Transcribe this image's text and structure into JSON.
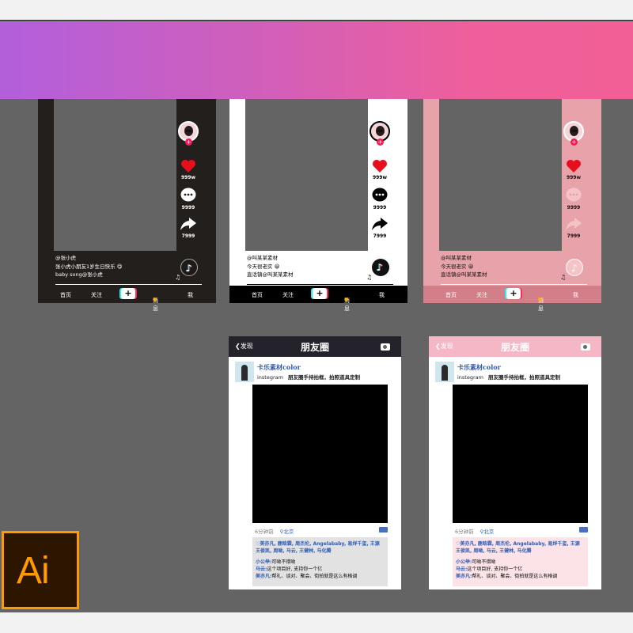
{
  "colors": {
    "canvas": "#646464",
    "banner_start": "#b25fdc",
    "banner_end": "#f25f96",
    "heart": "#e5101c",
    "ai_orange": "#ff9a00"
  },
  "tiktok": [
    {
      "theme": "black",
      "counts": {
        "likes": "999w",
        "comments": "9999",
        "shares": "7999"
      },
      "caption": {
        "user": "@张小虎",
        "desc": "张小虎小朋友1岁生日快乐 😋",
        "song": "baby song@张小虎"
      },
      "nav": {
        "home": "首页",
        "follow": "关注",
        "add": "+",
        "msg": "消息",
        "me": "我"
      }
    },
    {
      "theme": "white",
      "counts": {
        "likes": "999w",
        "comments": "9999",
        "shares": "7999"
      },
      "caption": {
        "user": "@叫某某素材",
        "desc": "今天很老实 😀",
        "song": "直话镇@叫某某素材"
      },
      "nav": {
        "home": "首页",
        "follow": "关注",
        "add": "+",
        "msg": "消息",
        "me": "我"
      }
    },
    {
      "theme": "pink",
      "counts": {
        "likes": "999w",
        "comments": "9999",
        "shares": "7999"
      },
      "caption": {
        "user": "@叫某某素材",
        "desc": "今天很老实 😀",
        "song": "直话镇@叫某某素材"
      },
      "nav": {
        "home": "首页",
        "follow": "关注",
        "add": "+",
        "msg": "消息",
        "me": "我"
      }
    }
  ],
  "moments": [
    {
      "back": "发现",
      "title": "朋友圈",
      "user_name": "卡乐素材color",
      "platform": "instegram",
      "subtitle": "朋友圈手持拍框，拍照道具定制",
      "time": "6分钟前",
      "location": "北京",
      "likes": "美亦凡, 鹿晗霖, 周杰伦, Angelababy, 易烊千玺, 王源 王俊凯, 周呦, 马云, 王健林, 马化腾",
      "comments": [
        {
          "who": "小公举:",
          "text": "可呦不错呦"
        },
        {
          "who": "马云:",
          "text": "这个项目好, 支持你一个亿"
        },
        {
          "who": "美亦凡:",
          "text": "帮礼、谈对、聚会、街拍就是这么有格调"
        }
      ]
    },
    {
      "back": "发现",
      "title": "朋友圈",
      "user_name": "卡乐素材color",
      "platform": "instegram",
      "subtitle": "朋友圈手持拍框，拍照道具定制",
      "time": "6分钟前",
      "location": "北京",
      "likes": "美亦凡, 鹿晗霖, 周杰伦, Angelababy, 易烊千玺, 王源 王俊凯, 周呦, 马云, 王健林, 马化腾",
      "comments": [
        {
          "who": "小公举:",
          "text": "可呦不错呦"
        },
        {
          "who": "马云:",
          "text": "这个项目好, 支持你一个亿"
        },
        {
          "who": "美亦凡:",
          "text": "帮礼、谈对、聚会、街拍就是这么有格调"
        }
      ]
    }
  ],
  "ai_logo": {
    "text": "Ai"
  }
}
